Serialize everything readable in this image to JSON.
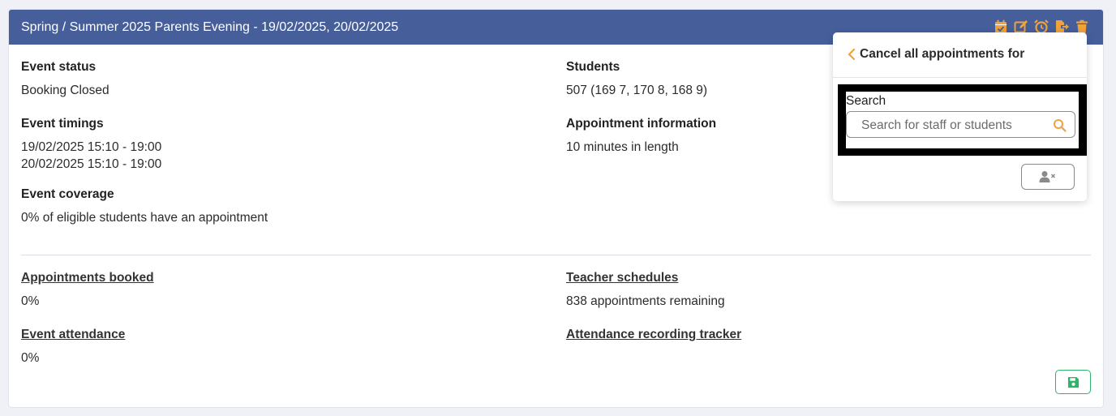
{
  "colors": {
    "header_bg": "#465f9b",
    "accent_orange": "#f0a23b",
    "save_green": "#2fb36b",
    "page_bg": "#eff1f6"
  },
  "event": {
    "title": "Spring / Summer 2025 Parents Evening - 19/02/2025, 20/02/2025"
  },
  "toolbar": {
    "icons": [
      "calendar-check-icon",
      "edit-icon",
      "alarm-clock-icon",
      "export-icon",
      "trash-icon"
    ]
  },
  "details": {
    "status_label": "Event status",
    "status_value": "Booking Closed",
    "timings_label": "Event timings",
    "timings_1": "19/02/2025 15:10 - 19:00",
    "timings_2": "20/02/2025 15:10 - 19:00",
    "coverage_label": "Event coverage",
    "coverage_value": "0% of eligible students have an appointment",
    "students_label": "Students",
    "students_value": "507 (169 7, 170 8, 168 9)",
    "appt_info_label": "Appointment information",
    "appt_info_value": "10 minutes in length"
  },
  "stats": {
    "booked_label": "Appointments booked",
    "booked_value": "0%",
    "attendance_label": "Event attendance",
    "attendance_value": "0%",
    "schedules_label": "Teacher schedules",
    "schedules_value": "838 appointments remaining",
    "tracker_label": "Attendance recording tracker"
  },
  "popover": {
    "title": "Cancel all appointments for",
    "search_label": "Search",
    "search_placeholder": "Search for staff or students"
  }
}
